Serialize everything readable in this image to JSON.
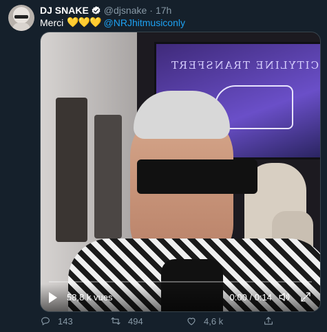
{
  "tweet": {
    "display_name": "DJ SNAKE",
    "handle": "@djsnake",
    "dot": "·",
    "time": "17h",
    "text": "Merci",
    "emoji": "💛💛💛",
    "mention": "@NRJhitmusiconly",
    "verified": true
  },
  "video": {
    "views": "58,8 k vues",
    "time": "0:00 / 0:14",
    "screen_text": "CITYLINE TRANSFERT"
  },
  "actions": {
    "reply_count": "143",
    "retweet_count": "494",
    "like_count": "4,6 k"
  },
  "colors": {
    "background": "#15202b",
    "muted": "#8899a6",
    "link": "#1da1f2",
    "verified": "#ffffff"
  },
  "icons": [
    "verified-badge-icon",
    "play-icon",
    "volume-icon",
    "fullscreen-icon",
    "reply-icon",
    "retweet-icon",
    "like-icon",
    "share-icon"
  ]
}
